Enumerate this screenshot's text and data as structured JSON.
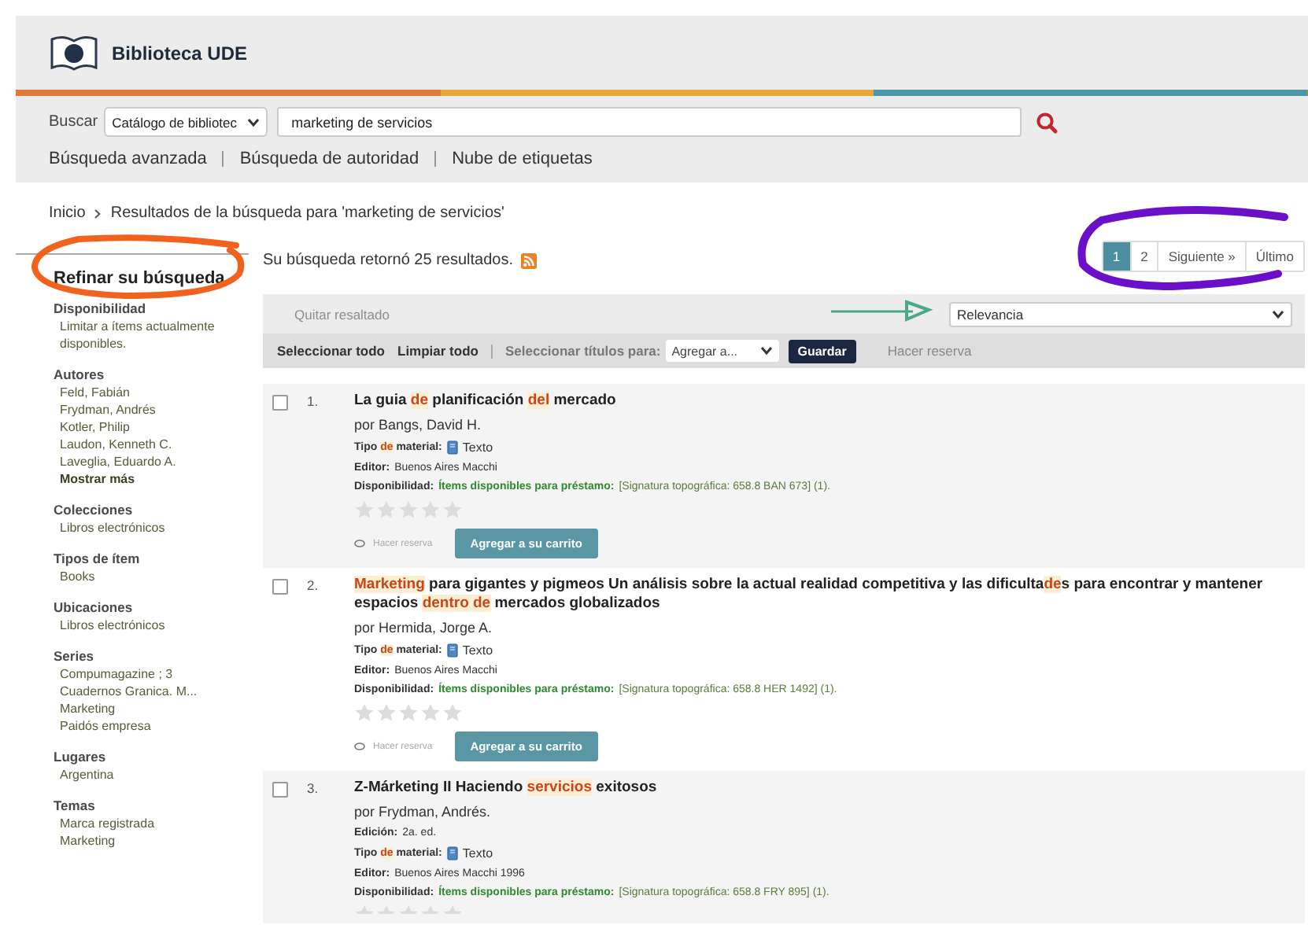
{
  "header": {
    "title": "Biblioteca UDE"
  },
  "search": {
    "label": "Buscar",
    "scope": "Catálogo de bibliotec",
    "query": "marketing de servicios"
  },
  "nav_links": [
    "Búsqueda avanzada",
    "Búsqueda de autoridad",
    "Nube de etiquetas"
  ],
  "breadcrumb": [
    "Inicio",
    "Resultados de la búsqueda para 'marketing de servicios'"
  ],
  "sidebar": {
    "title": "Refinar su búsqueda",
    "groups": [
      {
        "heading": "Disponibilidad",
        "items": [
          {
            "label": "Limitar a ítems actualmente disponibles.",
            "kind": "link"
          }
        ]
      },
      {
        "heading": "Autores",
        "items": [
          {
            "label": "Feld, Fabián",
            "kind": "link"
          },
          {
            "label": "Frydman, Andrés",
            "kind": "link"
          },
          {
            "label": "Kotler, Philip",
            "kind": "link"
          },
          {
            "label": "Laudon, Kenneth C.",
            "kind": "link"
          },
          {
            "label": "Laveglia, Eduardo A.",
            "kind": "link"
          },
          {
            "label": "Mostrar más",
            "kind": "more"
          }
        ]
      },
      {
        "heading": "Colecciones",
        "items": [
          {
            "label": "Libros electrónicos",
            "kind": "link"
          }
        ]
      },
      {
        "heading": "Tipos de ítem",
        "items": [
          {
            "label": "Books",
            "kind": "link"
          }
        ]
      },
      {
        "heading": "Ubicaciones",
        "items": [
          {
            "label": "Libros electrónicos",
            "kind": "link"
          }
        ]
      },
      {
        "heading": "Series",
        "items": [
          {
            "label": "Compumagazine ; 3",
            "kind": "link"
          },
          {
            "label": "Cuadernos Granica. M...",
            "kind": "link"
          },
          {
            "label": "Marketing",
            "kind": "link"
          },
          {
            "label": "Paidós empresa",
            "kind": "link"
          }
        ]
      },
      {
        "heading": "Lugares",
        "items": [
          {
            "label": "Argentina",
            "kind": "link"
          }
        ]
      },
      {
        "heading": "Temas",
        "items": [
          {
            "label": "Marca registrada",
            "kind": "link"
          },
          {
            "label": "Marketing",
            "kind": "link"
          }
        ]
      }
    ]
  },
  "results_summary": "Su búsqueda retornó 25 resultados.",
  "pagination": [
    {
      "label": "1",
      "selected": true
    },
    {
      "label": "2",
      "selected": false
    },
    {
      "label": "Siguiente »",
      "selected": false
    },
    {
      "label": "Último",
      "selected": false
    }
  ],
  "toolbar": {
    "highlight_toggle": "Quitar resaltado",
    "sort": "Relevancia",
    "select_all": "Seleccionar todo",
    "clear_all": "Limpiar todo",
    "select_titles_label": "Seleccionar títulos para:",
    "list_select": "Agregar a...",
    "save": "Guardar",
    "place_hold": "Hacer reserva"
  },
  "results": [
    {
      "number": "1.",
      "checked": false,
      "title": [
        {
          "text": "La guia ",
          "highlighted": false
        },
        {
          "text": "de",
          "highlighted": true
        },
        {
          "text": " planificación ",
          "highlighted": false
        },
        {
          "text": "del",
          "highlighted": true
        },
        {
          "text": " mercado",
          "highlighted": false
        }
      ],
      "author": "por Bangs, David H.",
      "fields": [
        {
          "kind": "material",
          "label": [
            {
              "text": "Tipo ",
              "highlighted": false
            },
            {
              "text": "de",
              "highlighted": true
            },
            {
              "text": " material:",
              "highlighted": false
            }
          ],
          "value": "Texto"
        },
        {
          "kind": "text",
          "label": [
            {
              "text": "Editor:",
              "highlighted": false
            }
          ],
          "value": "Buenos Aires Macchi"
        },
        {
          "kind": "availability",
          "label": [
            {
              "text": "Disponibilidad:",
              "highlighted": false
            }
          ],
          "status": "Ítems disponibles para préstamo:",
          "value": "[Signatura topográfica: 658.8 BAN 673] (1)."
        }
      ],
      "stars": 0,
      "hold": "Hacer reserva",
      "cart": "Agregar a su carrito"
    },
    {
      "number": "2.",
      "checked": false,
      "title": [
        {
          "text": "Marketing",
          "highlighted": true
        },
        {
          "text": " para gigantes y pigmeos Un análisis sobre la actual realidad competitiva y las dificulta",
          "highlighted": false
        },
        {
          "text": "de",
          "highlighted": true
        },
        {
          "text": "s para encontrar y mantener espacios ",
          "highlighted": false
        },
        {
          "text": "dentro de",
          "highlighted": true
        },
        {
          "text": " mercados globalizados",
          "highlighted": false
        }
      ],
      "author": "por Hermida, Jorge A.",
      "fields": [
        {
          "kind": "material",
          "label": [
            {
              "text": "Tipo ",
              "highlighted": false
            },
            {
              "text": "de",
              "highlighted": true
            },
            {
              "text": " material:",
              "highlighted": false
            }
          ],
          "value": "Texto"
        },
        {
          "kind": "text",
          "label": [
            {
              "text": "Editor:",
              "highlighted": false
            }
          ],
          "value": "Buenos Aires Macchi"
        },
        {
          "kind": "availability",
          "label": [
            {
              "text": "Disponibilidad:",
              "highlighted": false
            }
          ],
          "status": "Ítems disponibles para préstamo:",
          "value": "[Signatura topográfica: 658.8 HER 1492] (1)."
        }
      ],
      "stars": 0,
      "hold": "Hacer reserva",
      "cart": "Agregar a su carrito"
    },
    {
      "number": "3.",
      "checked": false,
      "title": [
        {
          "text": "Z-Márketing II Haciendo ",
          "highlighted": false
        },
        {
          "text": "servicios",
          "highlighted": true
        },
        {
          "text": " exitosos",
          "highlighted": false
        }
      ],
      "author": "por Frydman, Andrés.",
      "fields": [
        {
          "kind": "text",
          "label": [
            {
              "text": "Edición:",
              "highlighted": false
            }
          ],
          "value": "2a. ed."
        },
        {
          "kind": "material",
          "label": [
            {
              "text": "Tipo ",
              "highlighted": false
            },
            {
              "text": "de",
              "highlighted": true
            },
            {
              "text": " material:",
              "highlighted": false
            }
          ],
          "value": "Texto"
        },
        {
          "kind": "text",
          "label": [
            {
              "text": "Editor:",
              "highlighted": false
            }
          ],
          "value": "Buenos Aires Macchi 1996"
        },
        {
          "kind": "availability",
          "label": [
            {
              "text": "Disponibilidad:",
              "highlighted": false
            }
          ],
          "status": "Ítems disponibles para préstamo:",
          "value": "[Signatura topográfica: 658.8 FRY 895] (1)."
        }
      ],
      "stars": 0
    }
  ]
}
